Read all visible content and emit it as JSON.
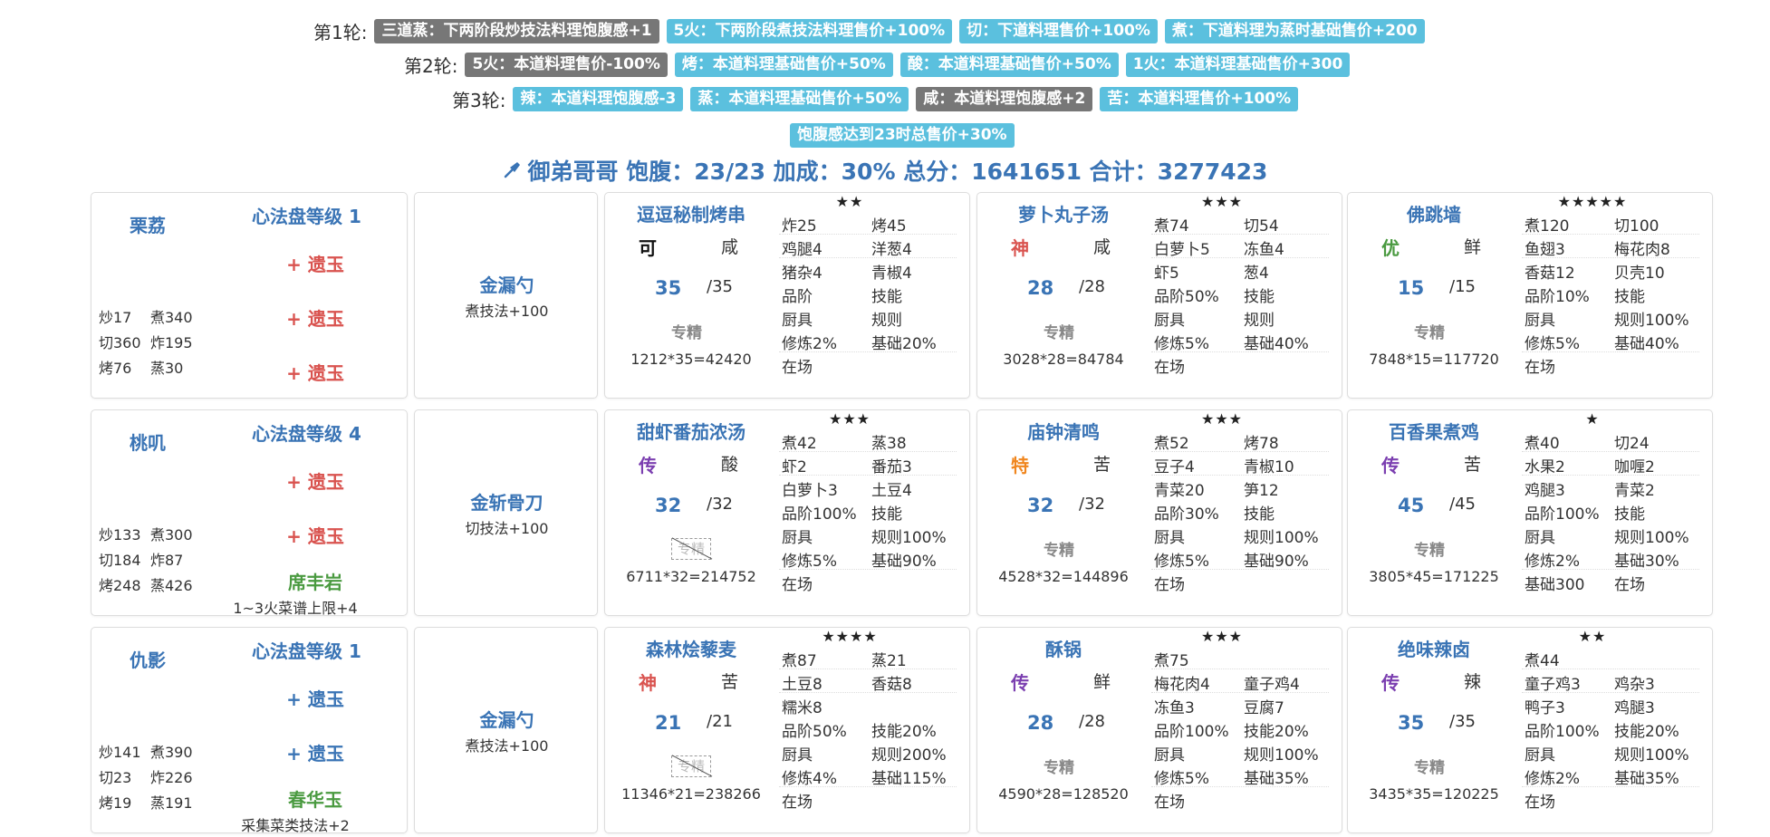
{
  "rules": [
    {
      "label": "第1轮:",
      "tags": [
        {
          "text": "三道蒸：下两阶段炒技法料理饱腹感+1",
          "style": "g"
        },
        {
          "text": "5火：下两阶段煮技法料理售价+100%",
          "style": "b"
        },
        {
          "text": "切：下道料理售价+100%",
          "style": "b"
        },
        {
          "text": "煮：下道料理为蒸时基础售价+200",
          "style": "b"
        }
      ]
    },
    {
      "label": "第2轮:",
      "tags": [
        {
          "text": "5火：本道料理售价-100%",
          "style": "g"
        },
        {
          "text": "烤：本道料理基础售价+50%",
          "style": "b"
        },
        {
          "text": "酸：本道料理基础售价+50%",
          "style": "b"
        },
        {
          "text": "1火：本道料理基础售价+300",
          "style": "b"
        }
      ]
    },
    {
      "label": "第3轮:",
      "tags": [
        {
          "text": "辣：本道料理饱腹感-3",
          "style": "b"
        },
        {
          "text": "蒸：本道料理基础售价+50%",
          "style": "b"
        },
        {
          "text": "咸：本道料理饱腹感+2",
          "style": "g"
        },
        {
          "text": "苦：本道料理售价+100%",
          "style": "b"
        }
      ]
    },
    {
      "label": "",
      "tags": [
        {
          "text": "饱腹感达到23时总售价+30%",
          "style": "b"
        }
      ]
    }
  ],
  "summary": {
    "icon": "pin-icon",
    "text": "御弟哥哥 饱腹：23/23 加成：30% 总分：1641651 合计：3277423"
  },
  "colors": {
    "blue": "#3a74b5",
    "tag_blue": "#5bc0de",
    "tag_gray": "#777",
    "red": "#d9534f",
    "green": "#4a9a40",
    "purple": "#7b3fb0",
    "orange": "#f0861e"
  },
  "rows": [
    {
      "chef": {
        "name": "栗荔",
        "level": "心法盘等级 1",
        "skills": [
          [
            "炒17",
            "煮340"
          ],
          [
            "切360",
            "炸195"
          ],
          [
            "烤76",
            "蒸30"
          ]
        ],
        "jade": [
          {
            "text": "+ 遗玉",
            "style": "red"
          },
          {
            "text": "+ 遗玉",
            "style": "red"
          },
          {
            "text": "+ 遗玉",
            "style": "red"
          }
        ],
        "extra": null
      },
      "equip": {
        "name": "金漏勺",
        "effect": "煮技法+100"
      },
      "recipes": [
        {
          "name": "逗逗秘制烤串",
          "stars": "★★",
          "grade": "可",
          "grade_color": "#111",
          "taste": "咸",
          "qty": "35",
          "max": "/35",
          "ex": "专精",
          "ex_mode": "text",
          "calc": "1212*35=42420",
          "rows": [
            [
              "炸25",
              "烤45"
            ],
            [
              "鸡腿4",
              "洋葱4"
            ],
            [
              "猪杂4",
              "青椒4"
            ],
            [
              "品阶",
              "技能"
            ],
            [
              "厨具",
              "规则"
            ],
            [
              "修炼2%",
              "基础20%"
            ],
            [
              "在场",
              ""
            ]
          ]
        },
        {
          "name": "萝卜丸子汤",
          "stars": "★★★",
          "grade": "神",
          "grade_color": "#d9534f",
          "taste": "咸",
          "qty": "28",
          "max": "/28",
          "ex": "专精",
          "ex_mode": "text",
          "calc": "3028*28=84784",
          "rows": [
            [
              "煮74",
              "切54"
            ],
            [
              "白萝卜5",
              "冻鱼4"
            ],
            [
              "虾5",
              "葱4"
            ],
            [
              "品阶50%",
              "技能"
            ],
            [
              "厨具",
              "规则"
            ],
            [
              "修炼5%",
              "基础40%"
            ],
            [
              "在场",
              ""
            ]
          ]
        },
        {
          "name": "佛跳墙",
          "stars": "★★★★★",
          "grade": "优",
          "grade_color": "#4a9a40",
          "taste": "鲜",
          "qty": "15",
          "max": "/15",
          "ex": "专精",
          "ex_mode": "text",
          "calc": "7848*15=117720",
          "rows": [
            [
              "煮120",
              "切100"
            ],
            [
              "鱼翅3",
              "梅花肉8"
            ],
            [
              "香菇12",
              "贝壳10"
            ],
            [
              "品阶10%",
              "技能"
            ],
            [
              "厨具",
              "规则100%"
            ],
            [
              "修炼5%",
              "基础40%"
            ],
            [
              "在场",
              ""
            ]
          ]
        }
      ]
    },
    {
      "chef": {
        "name": "桃叽",
        "level": "心法盘等级 4",
        "skills": [
          [
            "炒133",
            "煮300"
          ],
          [
            "切184",
            "炸87"
          ],
          [
            "烤248",
            "蒸426"
          ]
        ],
        "jade": [
          {
            "text": "+ 遗玉",
            "style": "red"
          },
          {
            "text": "+ 遗玉",
            "style": "red"
          },
          {
            "text": "席丰岩",
            "style": "green"
          }
        ],
        "extra": "1~3火菜谱上限+4"
      },
      "equip": {
        "name": "金斩骨刀",
        "effect": "切技法+100"
      },
      "recipes": [
        {
          "name": "甜虾番茄浓汤",
          "stars": "★★★",
          "grade": "传",
          "grade_color": "#7b3fb0",
          "taste": "酸",
          "qty": "32",
          "max": "/32",
          "ex": "专精",
          "ex_mode": "struck",
          "calc": "6711*32=214752",
          "rows": [
            [
              "煮42",
              "蒸38"
            ],
            [
              "虾2",
              "番茄3"
            ],
            [
              "白萝卜3",
              "土豆4"
            ],
            [
              "品阶100%",
              "技能"
            ],
            [
              "厨具",
              "规则100%"
            ],
            [
              "修炼5%",
              "基础90%"
            ],
            [
              "在场",
              ""
            ]
          ]
        },
        {
          "name": "庙钟清鸣",
          "stars": "★★★",
          "grade": "特",
          "grade_color": "#f0861e",
          "taste": "苦",
          "qty": "32",
          "max": "/32",
          "ex": "专精",
          "ex_mode": "text",
          "calc": "4528*32=144896",
          "rows": [
            [
              "煮52",
              "烤78"
            ],
            [
              "豆子4",
              "青椒10"
            ],
            [
              "青菜20",
              "笋12"
            ],
            [
              "品阶30%",
              "技能"
            ],
            [
              "厨具",
              "规则100%"
            ],
            [
              "修炼5%",
              "基础90%"
            ],
            [
              "在场",
              ""
            ]
          ]
        },
        {
          "name": "百香果煮鸡",
          "stars": "★",
          "grade": "传",
          "grade_color": "#7b3fb0",
          "taste": "苦",
          "qty": "45",
          "max": "/45",
          "ex": "专精",
          "ex_mode": "text",
          "calc": "3805*45=171225",
          "rows": [
            [
              "煮40",
              "切24"
            ],
            [
              "水果2",
              "咖喱2"
            ],
            [
              "鸡腿3",
              "青菜2"
            ],
            [
              "品阶100%",
              "技能"
            ],
            [
              "厨具",
              "规则100%"
            ],
            [
              "修炼2%",
              "基础30%"
            ],
            [
              "基础300",
              "在场"
            ]
          ]
        }
      ]
    },
    {
      "chef": {
        "name": "仇影",
        "level": "心法盘等级 1",
        "skills": [
          [
            "炒141",
            "煮390"
          ],
          [
            "切23",
            "炸226"
          ],
          [
            "烤19",
            "蒸191"
          ]
        ],
        "jade": [
          {
            "text": "+ 遗玉",
            "style": "blue"
          },
          {
            "text": "+ 遗玉",
            "style": "blue"
          },
          {
            "text": "春华玉",
            "style": "green"
          }
        ],
        "extra": "采集菜类技法+2"
      },
      "equip": {
        "name": "金漏勺",
        "effect": "煮技法+100"
      },
      "recipes": [
        {
          "name": "森林烩藜麦",
          "stars": "★★★★",
          "grade": "神",
          "grade_color": "#d9534f",
          "taste": "苦",
          "qty": "21",
          "max": "/21",
          "ex": "专精",
          "ex_mode": "struck",
          "calc": "11346*21=238266",
          "rows": [
            [
              "煮87",
              "蒸21"
            ],
            [
              "土豆8",
              "香菇8"
            ],
            [
              "糯米8",
              ""
            ],
            [
              "品阶50%",
              "技能20%"
            ],
            [
              "厨具",
              "规则200%"
            ],
            [
              "修炼4%",
              "基础115%"
            ],
            [
              "在场",
              ""
            ]
          ]
        },
        {
          "name": "酥锅",
          "stars": "★★★",
          "grade": "传",
          "grade_color": "#7b3fb0",
          "taste": "鲜",
          "qty": "28",
          "max": "/28",
          "ex": "专精",
          "ex_mode": "text",
          "calc": "4590*28=128520",
          "rows": [
            [
              "煮75",
              ""
            ],
            [
              "梅花肉4",
              "童子鸡4"
            ],
            [
              "冻鱼3",
              "豆腐7"
            ],
            [
              "品阶100%",
              "技能20%"
            ],
            [
              "厨具",
              "规则100%"
            ],
            [
              "修炼5%",
              "基础35%"
            ],
            [
              "在场",
              ""
            ]
          ]
        },
        {
          "name": "绝味辣卤",
          "stars": "★★",
          "grade": "传",
          "grade_color": "#7b3fb0",
          "taste": "辣",
          "qty": "35",
          "max": "/35",
          "ex": "专精",
          "ex_mode": "text",
          "calc": "3435*35=120225",
          "rows": [
            [
              "煮44",
              ""
            ],
            [
              "童子鸡3",
              "鸡杂3"
            ],
            [
              "鸭子3",
              "鸡腿3"
            ],
            [
              "品阶100%",
              "技能20%"
            ],
            [
              "厨具",
              "规则100%"
            ],
            [
              "修炼2%",
              "基础35%"
            ],
            [
              "在场",
              ""
            ]
          ]
        }
      ]
    }
  ]
}
